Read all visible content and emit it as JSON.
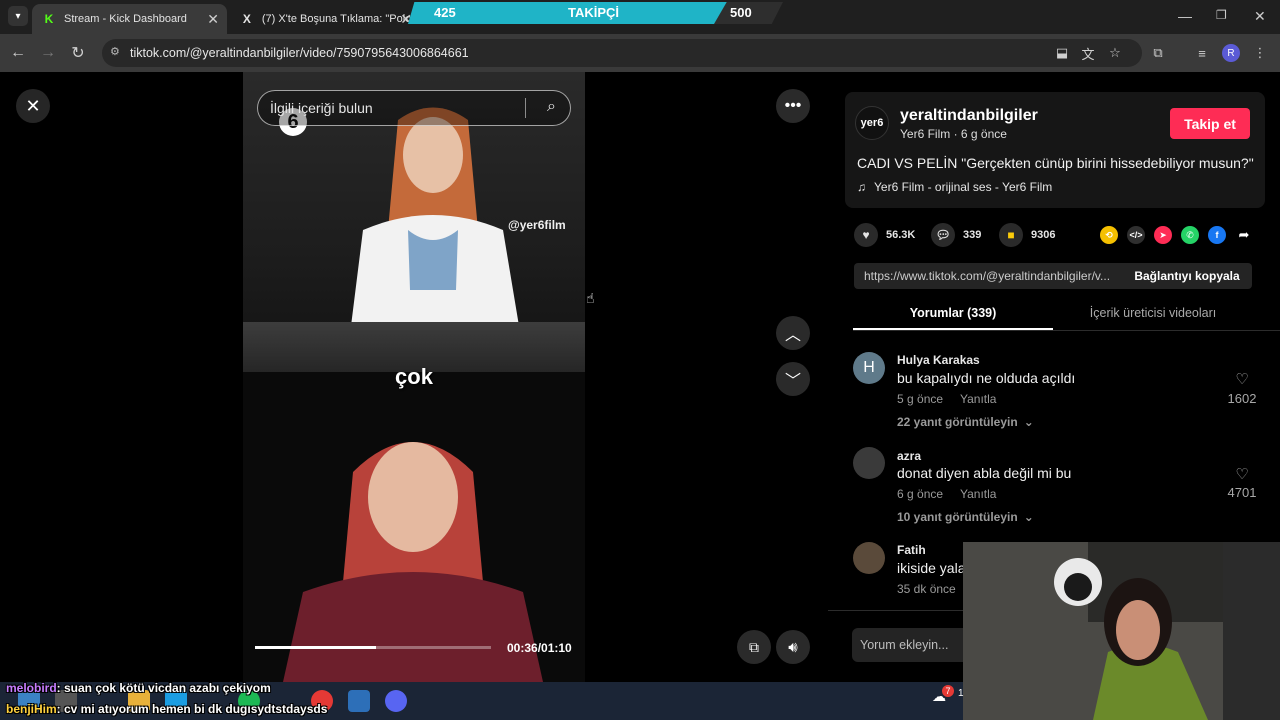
{
  "browser": {
    "tabs": [
      {
        "title": "Stream - Kick Dashboard",
        "icon": "kick-icon",
        "active": true
      },
      {
        "title": "(7) X'te Boşuna Tıklama: \"Polon",
        "icon": "x-icon",
        "active": false
      }
    ],
    "url": "tiktok.com/@yeraltindanbilgiler/video/7590795643006864661",
    "profile_initial": "R"
  },
  "overlay": {
    "follow_goal": {
      "current": "425",
      "label": "TAKİPÇİ",
      "target": "500",
      "progress": 0.85
    }
  },
  "video": {
    "search_placeholder": "İlgili içeriği bulun",
    "watermark": "@yer6film",
    "channel_logo": "6",
    "caption": "çok",
    "time": "00:36/01:10",
    "progress": 0.514
  },
  "post": {
    "logo_text": "yer6",
    "username": "yeraltindanbilgiler",
    "meta": "Yer6 Film · 6 g önce",
    "follow_label": "Takip et",
    "description": "CADI VS PELİN \"Gerçekten cünüp birini hissedebiliyor musun?\"",
    "sound": "Yer6 Film - orijinal ses - Yer6 Film",
    "likes": "56.3K",
    "comments": "339",
    "saves": "9306",
    "link": "https://www.tiktok.com/@yeraltindanbilgiler/v...",
    "copy_label": "Bağlantıyı kopyala",
    "tabs": [
      "Yorumlar (339)",
      "İçerik üreticisi videoları"
    ]
  },
  "comments": [
    {
      "initial": "H",
      "name": "Hulya Karakas",
      "text": "bu kapalıydı ne olduda açıldı",
      "time": "5 g önce",
      "reply": "Yanıtla",
      "likes": "1602",
      "more": "22 yanıt görüntüleyin"
    },
    {
      "initial": "",
      "name": "azra",
      "text": "donat diyen abla değil mi bu",
      "time": "6 g önce",
      "reply": "Yanıtla",
      "likes": "4701",
      "more": "10 yanıt görüntüleyin"
    },
    {
      "initial": "",
      "name": "Fatih",
      "text": "ikiside yala",
      "time": "35 dk önce",
      "reply": "",
      "likes": "",
      "more": ""
    }
  ],
  "comment_input_placeholder": "Yorum ekleyin...",
  "chat": [
    {
      "user": "melobird",
      "message": ": suan çok kötü vicdan azabı çekiyom",
      "color": "#c77dff"
    },
    {
      "user": "benjiHim",
      "message": ": cv mi atıyorum hemen bi dk dugısydtstdaysds",
      "color": "#ffd23f"
    }
  ],
  "taskbar": {
    "badge": "7",
    "tray_text": "1"
  },
  "colors": {
    "accent": "#fe2c55",
    "goal_fill": "#1fb4c7"
  }
}
